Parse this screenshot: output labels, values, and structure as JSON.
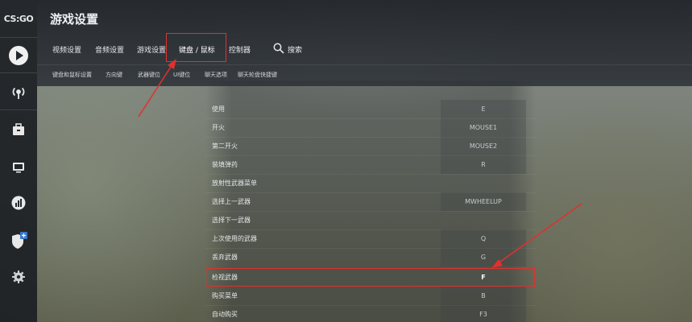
{
  "sidebar": {
    "logo": "CS:GO",
    "icons": [
      "play-icon",
      "broadcast-icon",
      "inventory-icon",
      "watch-tv-icon",
      "stats-icon",
      "shield-plus-icon",
      "gear-icon"
    ]
  },
  "header": {
    "title": "游戏设置",
    "tabs": [
      {
        "label": "视频设置"
      },
      {
        "label": "音频设置"
      },
      {
        "label": "游戏设置"
      },
      {
        "label": "键盘 / 鼠标"
      },
      {
        "label": "控制器"
      }
    ],
    "search_label": "搜索",
    "subtabs": [
      {
        "label": "键盘和鼠标设置"
      },
      {
        "label": "方向键"
      },
      {
        "label": "武器键位"
      },
      {
        "label": "UI键位"
      },
      {
        "label": "聊天选项"
      },
      {
        "label": "聊天轮盘快捷键"
      }
    ]
  },
  "bindings": [
    {
      "action": "使用",
      "key": "E"
    },
    {
      "action": "开火",
      "key": "MOUSE1"
    },
    {
      "action": "第二开火",
      "key": "MOUSE2"
    },
    {
      "action": "装填弹药",
      "key": "R"
    },
    {
      "action": "放射性武器菜单",
      "key": ""
    },
    {
      "action": "选择上一武器",
      "key": "MWHEELUP"
    },
    {
      "action": "选择下一武器",
      "key": ""
    },
    {
      "action": "上次使用的武器",
      "key": "Q"
    },
    {
      "action": "丢弃武器",
      "key": "G"
    },
    {
      "action": "检视武器",
      "key": "F"
    },
    {
      "action": "购买菜单",
      "key": "B"
    },
    {
      "action": "自动购买",
      "key": "F3"
    }
  ],
  "colors": {
    "annotation": "#e0312e"
  }
}
